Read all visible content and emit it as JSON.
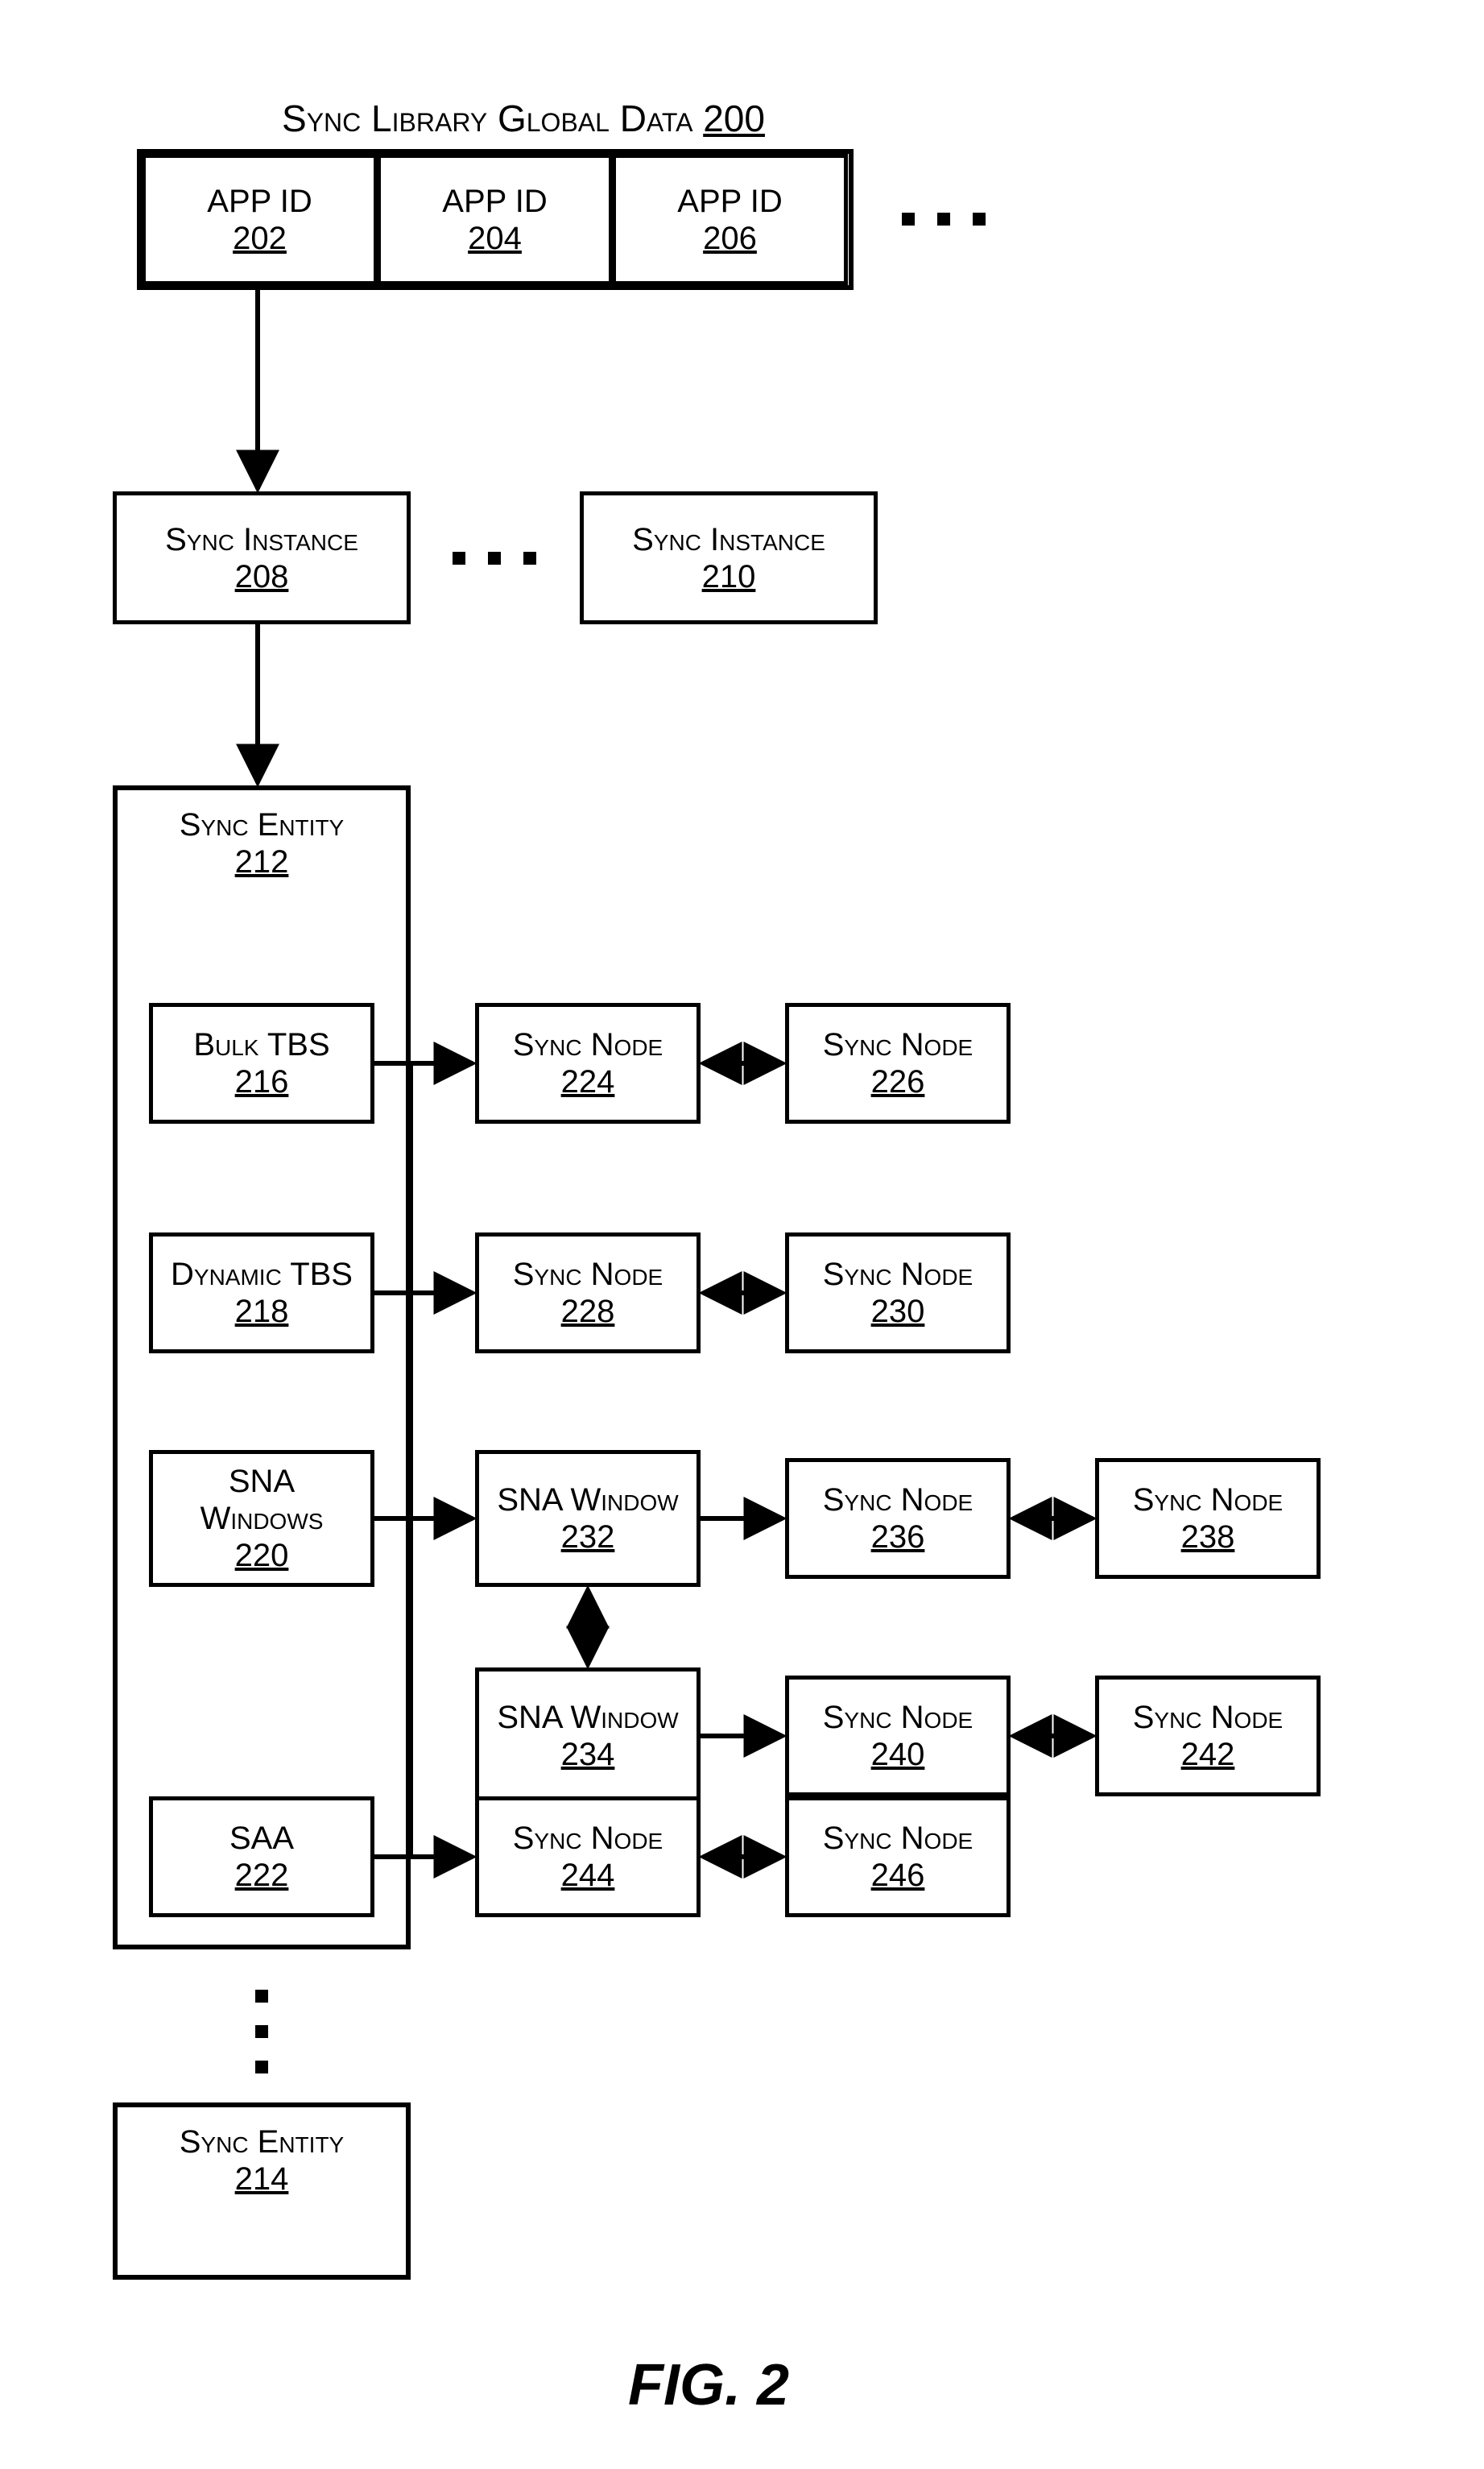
{
  "header": {
    "title_text": "Sync Library Global Data",
    "title_num": "200"
  },
  "app_ids": [
    {
      "label": "APP ID",
      "num": "202"
    },
    {
      "label": "APP ID",
      "num": "204"
    },
    {
      "label": "APP ID",
      "num": "206"
    }
  ],
  "sync_instances": [
    {
      "label": "Sync Instance",
      "num": "208"
    },
    {
      "label": "Sync Instance",
      "num": "210"
    }
  ],
  "sync_entity_main": {
    "label": "Sync Entity",
    "num": "212"
  },
  "entity_items": {
    "bulk_tbs": {
      "label": "Bulk TBS",
      "num": "216"
    },
    "dynamic_tbs": {
      "label": "Dynamic TBS",
      "num": "218"
    },
    "sna_windows": {
      "label1": "SNA",
      "label2": "Windows",
      "num": "220"
    },
    "saa": {
      "label": "SAA",
      "num": "222"
    }
  },
  "nodes": {
    "n224": {
      "label": "Sync Node",
      "num": "224"
    },
    "n226": {
      "label": "Sync Node",
      "num": "226"
    },
    "n228": {
      "label": "Sync Node",
      "num": "228"
    },
    "n230": {
      "label": "Sync Node",
      "num": "230"
    },
    "n232": {
      "label": "SNA Window",
      "num": "232"
    },
    "n234": {
      "label": "SNA Window",
      "num": "234"
    },
    "n236": {
      "label": "Sync Node",
      "num": "236"
    },
    "n238": {
      "label": "Sync Node",
      "num": "238"
    },
    "n240": {
      "label": "Sync Node",
      "num": "240"
    },
    "n242": {
      "label": "Sync Node",
      "num": "242"
    },
    "n244": {
      "label": "Sync Node",
      "num": "244"
    },
    "n246": {
      "label": "Sync Node",
      "num": "246"
    }
  },
  "sync_entity_secondary": {
    "label": "Sync Entity",
    "num": "214"
  },
  "caption": "FIG. 2"
}
